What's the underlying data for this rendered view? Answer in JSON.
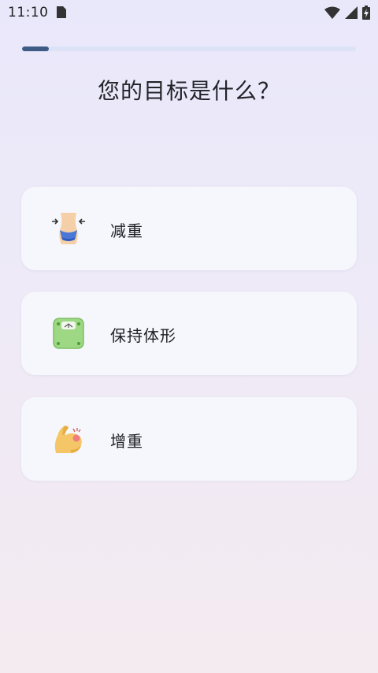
{
  "status_bar": {
    "time": "11:10",
    "icons": [
      "sim-card-icon",
      "wifi-icon",
      "cellular-signal-icon",
      "battery-charging-icon"
    ]
  },
  "progress": {
    "value": 0.08,
    "fill_color": "#3e5b85",
    "track_color": "#dde3f6"
  },
  "title": "您的目标是什么？",
  "goals": [
    {
      "label": "减重",
      "icon": "waist-slimming-icon"
    },
    {
      "label": "保持体形",
      "icon": "bathroom-scale-icon"
    },
    {
      "label": "增重",
      "icon": "flexed-bicep-icon"
    }
  ]
}
